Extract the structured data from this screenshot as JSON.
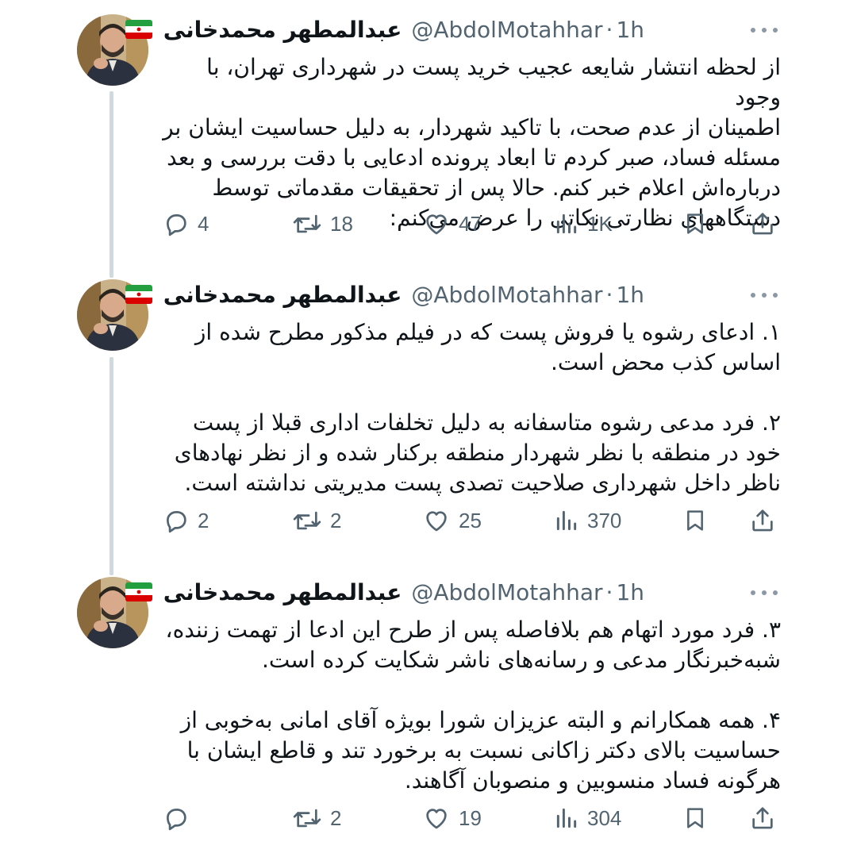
{
  "tweets": [
    {
      "author_name": "عبدالمطهر محمدخانی",
      "handle": "@AbdolMotahhar",
      "separator": "·",
      "time": "1h",
      "text": "از لحظه انتشار شایعه عجیب خرید پست در شهرداری تهران، با وجود\nاطمینان از عدم صحت، با تاکید شهردار، به دلیل حساسیت ایشان بر\nمسئله فساد، صبر کردم تا ابعاد پرونده ادعایی با دقت بررسی و بعد\nدرباره‌اش اعلام خبر کنم. حالا پس از تحقیقات مقدماتی توسط\nدستگاههای نظارتی نکاتی را عرض می‌کنم:",
      "replies": "4",
      "retweets": "18",
      "likes": "47",
      "views": "1K"
    },
    {
      "author_name": "عبدالمطهر محمدخانی",
      "handle": "@AbdolMotahhar",
      "separator": "·",
      "time": "1h",
      "text": "۱. ادعای رشوه یا فروش پست که در فیلم مذکور مطرح شده از\nاساس کذب محض است.\n\n۲. فرد مدعی رشوه متاسفانه به دلیل تخلفات اداری قبلا از پست\nخود در منطقه با نظر شهردار منطقه برکنار شده و از نظر نهادهای\nناظر داخل شهرداری صلاحیت تصدی پست مدیریتی نداشته است.",
      "replies": "2",
      "retweets": "2",
      "likes": "25",
      "views": "370"
    },
    {
      "author_name": "عبدالمطهر محمدخانی",
      "handle": "@AbdolMotahhar",
      "separator": "·",
      "time": "1h",
      "text": "۳. فرد مورد اتهام هم بلافاصله پس از طرح این ادعا از تهمت زننده،\nشبه‌خبرنگار مدعی و رسانه‌های ناشر شکایت کرده است.\n\n۴. همه همکارانم و البته عزیزان شورا بویژه آقای امانی به‌خوبی از\nحساسیت بالای دکتر زاکانی نسبت به برخورد تند و قاطع ایشان با\nهرگونه فساد منسوبین و منصوبان آگاهند.",
      "replies": "",
      "retweets": "2",
      "likes": "19",
      "views": "304"
    }
  ],
  "icons": {
    "reply": "reply-icon",
    "retweet": "retweet-icon",
    "like": "heart-icon",
    "views": "views-icon",
    "bookmark": "bookmark-icon",
    "share": "share-icon",
    "more": "more-icon",
    "flag": "iran-flag-icon"
  },
  "colors": {
    "text": "#0f1419",
    "secondary": "#536471",
    "thread_line": "#cfd9de"
  }
}
